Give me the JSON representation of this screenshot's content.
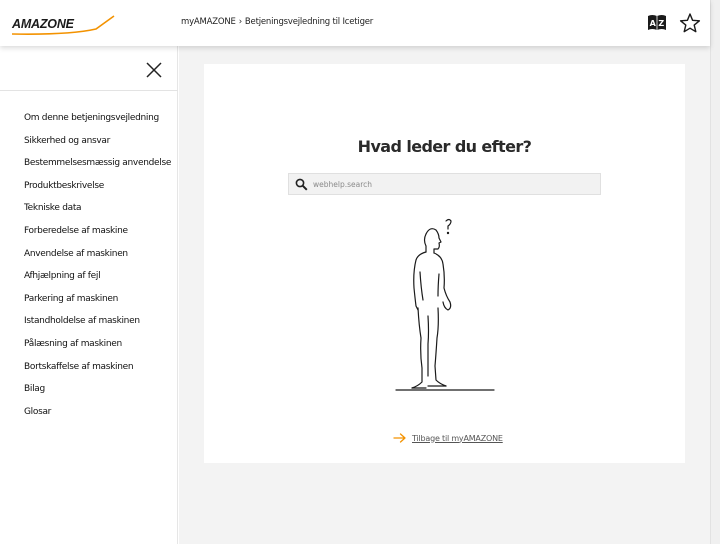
{
  "header": {
    "logo_text": "AMAZONE",
    "breadcrumb": {
      "home": "myAMAZONE",
      "separator": "›",
      "current": "Betjeningsvejledning til Icetiger"
    },
    "icons": {
      "dictionary": "dictionary-az-icon",
      "favorite": "star-icon"
    }
  },
  "sidebar": {
    "close_icon": "close-icon",
    "items": [
      {
        "label": "Om denne betjeningsvejledning"
      },
      {
        "label": "Sikkerhed og ansvar"
      },
      {
        "label": "Bestemmelsesmæssig anvendelse"
      },
      {
        "label": "Produktbeskrivelse"
      },
      {
        "label": "Tekniske data"
      },
      {
        "label": "Forberedelse af maskine"
      },
      {
        "label": "Anvendelse af maskinen"
      },
      {
        "label": "Afhjælpning af fejl"
      },
      {
        "label": "Parkering af maskinen"
      },
      {
        "label": "Istandholdelse af maskinen"
      },
      {
        "label": "Pålæsning af maskinen"
      },
      {
        "label": "Bortskaffelse af maskinen"
      },
      {
        "label": "Bilag"
      },
      {
        "label": "Glosar"
      }
    ]
  },
  "main": {
    "title": "Hvad leder du efter?",
    "search": {
      "placeholder": "webhelp.search",
      "value": ""
    },
    "figure_icon": "confused-person-illustration",
    "back_link": "Tilbage til myAMAZONE"
  },
  "colors": {
    "accent": "#f39200",
    "logo": "#1a1a1a",
    "background": "#f3f3f3"
  }
}
